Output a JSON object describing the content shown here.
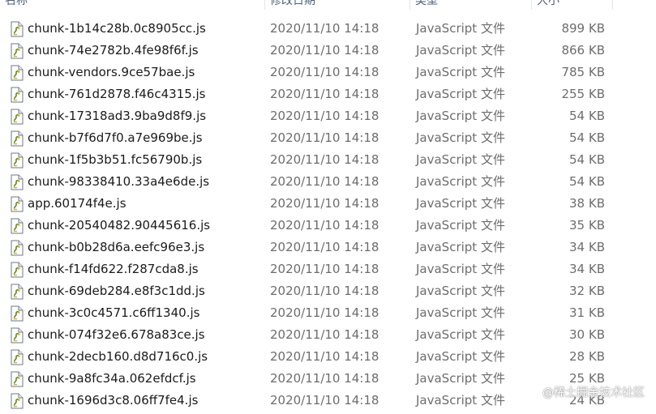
{
  "columns": {
    "name": "名称",
    "date": "修改日期",
    "type": "类型",
    "size": "大小"
  },
  "files": [
    {
      "name": "chunk-1b14c28b.0c8905cc.js",
      "date": "2020/11/10 14:18",
      "type": "JavaScript 文件",
      "size": "899 KB",
      "icon": "js-file-icon"
    },
    {
      "name": "chunk-74e2782b.4fe98f6f.js",
      "date": "2020/11/10 14:18",
      "type": "JavaScript 文件",
      "size": "866 KB",
      "icon": "js-file-icon"
    },
    {
      "name": "chunk-vendors.9ce57bae.js",
      "date": "2020/11/10 14:18",
      "type": "JavaScript 文件",
      "size": "785 KB",
      "icon": "js-file-icon"
    },
    {
      "name": "chunk-761d2878.f46c4315.js",
      "date": "2020/11/10 14:18",
      "type": "JavaScript 文件",
      "size": "255 KB",
      "icon": "js-file-icon"
    },
    {
      "name": "chunk-17318ad3.9ba9d8f9.js",
      "date": "2020/11/10 14:18",
      "type": "JavaScript 文件",
      "size": "54 KB",
      "icon": "js-file-icon"
    },
    {
      "name": "chunk-b7f6d7f0.a7e969be.js",
      "date": "2020/11/10 14:18",
      "type": "JavaScript 文件",
      "size": "54 KB",
      "icon": "js-file-icon"
    },
    {
      "name": "chunk-1f5b3b51.fc56790b.js",
      "date": "2020/11/10 14:18",
      "type": "JavaScript 文件",
      "size": "54 KB",
      "icon": "js-file-icon"
    },
    {
      "name": "chunk-98338410.33a4e6de.js",
      "date": "2020/11/10 14:18",
      "type": "JavaScript 文件",
      "size": "54 KB",
      "icon": "js-file-icon"
    },
    {
      "name": "app.60174f4e.js",
      "date": "2020/11/10 14:18",
      "type": "JavaScript 文件",
      "size": "38 KB",
      "icon": "js-file-icon"
    },
    {
      "name": "chunk-20540482.90445616.js",
      "date": "2020/11/10 14:18",
      "type": "JavaScript 文件",
      "size": "35 KB",
      "icon": "js-file-icon"
    },
    {
      "name": "chunk-b0b28d6a.eefc96e3.js",
      "date": "2020/11/10 14:18",
      "type": "JavaScript 文件",
      "size": "34 KB",
      "icon": "js-file-icon"
    },
    {
      "name": "chunk-f14fd622.f287cda8.js",
      "date": "2020/11/10 14:18",
      "type": "JavaScript 文件",
      "size": "34 KB",
      "icon": "js-file-icon"
    },
    {
      "name": "chunk-69deb284.e8f3c1dd.js",
      "date": "2020/11/10 14:18",
      "type": "JavaScript 文件",
      "size": "32 KB",
      "icon": "js-file-icon"
    },
    {
      "name": "chunk-3c0c4571.c6ff1340.js",
      "date": "2020/11/10 14:18",
      "type": "JavaScript 文件",
      "size": "31 KB",
      "icon": "js-file-icon"
    },
    {
      "name": "chunk-074f32e6.678a83ce.js",
      "date": "2020/11/10 14:18",
      "type": "JavaScript 文件",
      "size": "30 KB",
      "icon": "js-file-icon"
    },
    {
      "name": "chunk-2decb160.d8d716c0.js",
      "date": "2020/11/10 14:18",
      "type": "JavaScript 文件",
      "size": "28 KB",
      "icon": "js-file-icon"
    },
    {
      "name": "chunk-9a8fc34a.062efdcf.js",
      "date": "2020/11/10 14:18",
      "type": "JavaScript 文件",
      "size": "25 KB",
      "icon": "js-file-icon"
    },
    {
      "name": "chunk-1696d3c8.06ff7fe4.js",
      "date": "2020/11/10 14:18",
      "type": "JavaScript 文件",
      "size": "24 KB",
      "icon": "js-file-icon"
    }
  ],
  "watermark": "@稀土掘金技术社区",
  "colors": {
    "name_text": "#1b1b1b",
    "detail_text": "#6d6d6d",
    "header_text": "#4c607a"
  }
}
